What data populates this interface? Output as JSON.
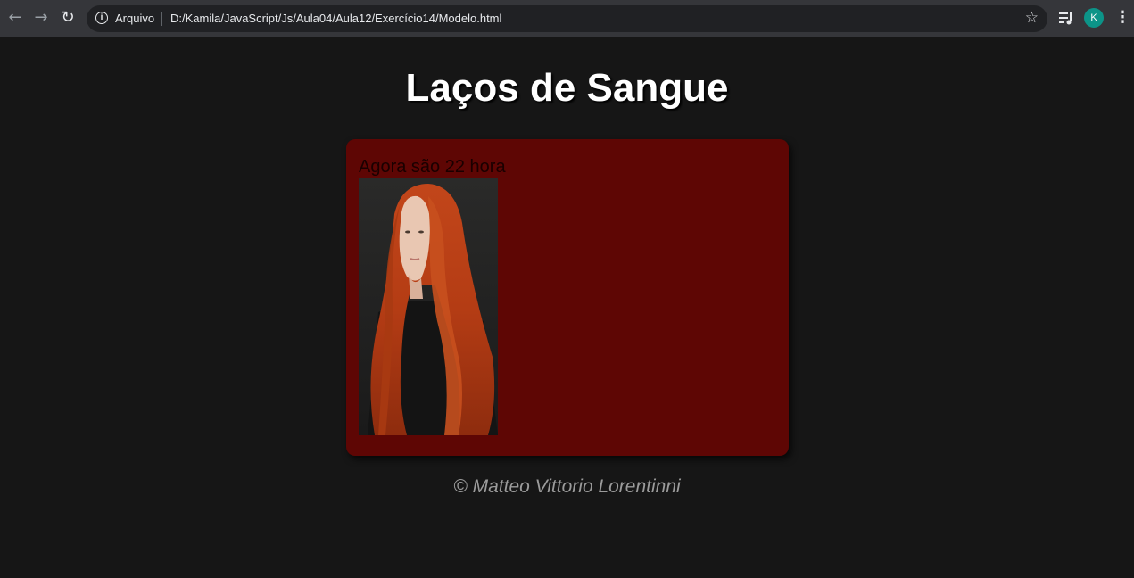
{
  "browser": {
    "protocol_label": "Arquivo",
    "url": "D:/Kamila/JavaScript/Js/Aula04/Aula12/Exercício14/Modelo.html",
    "avatar_initial": "K",
    "icons": [
      "back-icon",
      "forward-icon",
      "reload-icon",
      "info-icon",
      "star-icon",
      "playlist-icon",
      "menu-icon"
    ]
  },
  "page": {
    "title": "Laços de Sangue",
    "message": "Agora são 22 hora",
    "footer": "© Matteo Vittorio Lorentinni"
  },
  "colors": {
    "background": "#161616",
    "card": "#5e0604",
    "avatar": "#0c9488"
  }
}
